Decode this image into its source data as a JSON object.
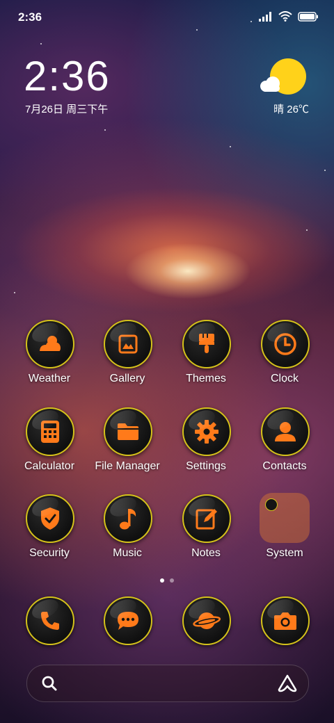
{
  "status_bar": {
    "time": "2:36",
    "icons": [
      "signal-icon",
      "wifi-icon",
      "battery-icon"
    ]
  },
  "clock_widget": {
    "time": "2:36",
    "date": "7月26日 周三下午"
  },
  "weather_widget": {
    "icon": "partly-cloudy-icon",
    "text": "晴 26℃"
  },
  "apps": [
    {
      "label": "Weather",
      "icon": "weather-icon"
    },
    {
      "label": "Gallery",
      "icon": "gallery-icon"
    },
    {
      "label": "Themes",
      "icon": "paintbrush-icon"
    },
    {
      "label": "Clock",
      "icon": "clock-icon"
    },
    {
      "label": "Calculator",
      "icon": "calculator-icon"
    },
    {
      "label": "File Manager",
      "icon": "folder-icon"
    },
    {
      "label": "Settings",
      "icon": "gear-icon"
    },
    {
      "label": "Contacts",
      "icon": "person-icon"
    },
    {
      "label": "Security",
      "icon": "shield-icon"
    },
    {
      "label": "Music",
      "icon": "music-note-icon"
    },
    {
      "label": "Notes",
      "icon": "notes-icon"
    },
    {
      "label": "System",
      "icon": "folder-group-icon"
    }
  ],
  "dock": [
    {
      "icon": "phone-icon"
    },
    {
      "icon": "message-icon"
    },
    {
      "icon": "browser-planet-icon"
    },
    {
      "icon": "camera-icon"
    }
  ],
  "page_indicator": {
    "pages": 2,
    "current": 1
  },
  "search_bar": {
    "left_icon": "search-icon",
    "right_icon": "assistant-icon"
  },
  "colors": {
    "icon_orange": "#ff7a1a",
    "icon_ring": "#d4c21a",
    "icon_bg": "#141414",
    "weather_sun": "#ffd21a"
  }
}
